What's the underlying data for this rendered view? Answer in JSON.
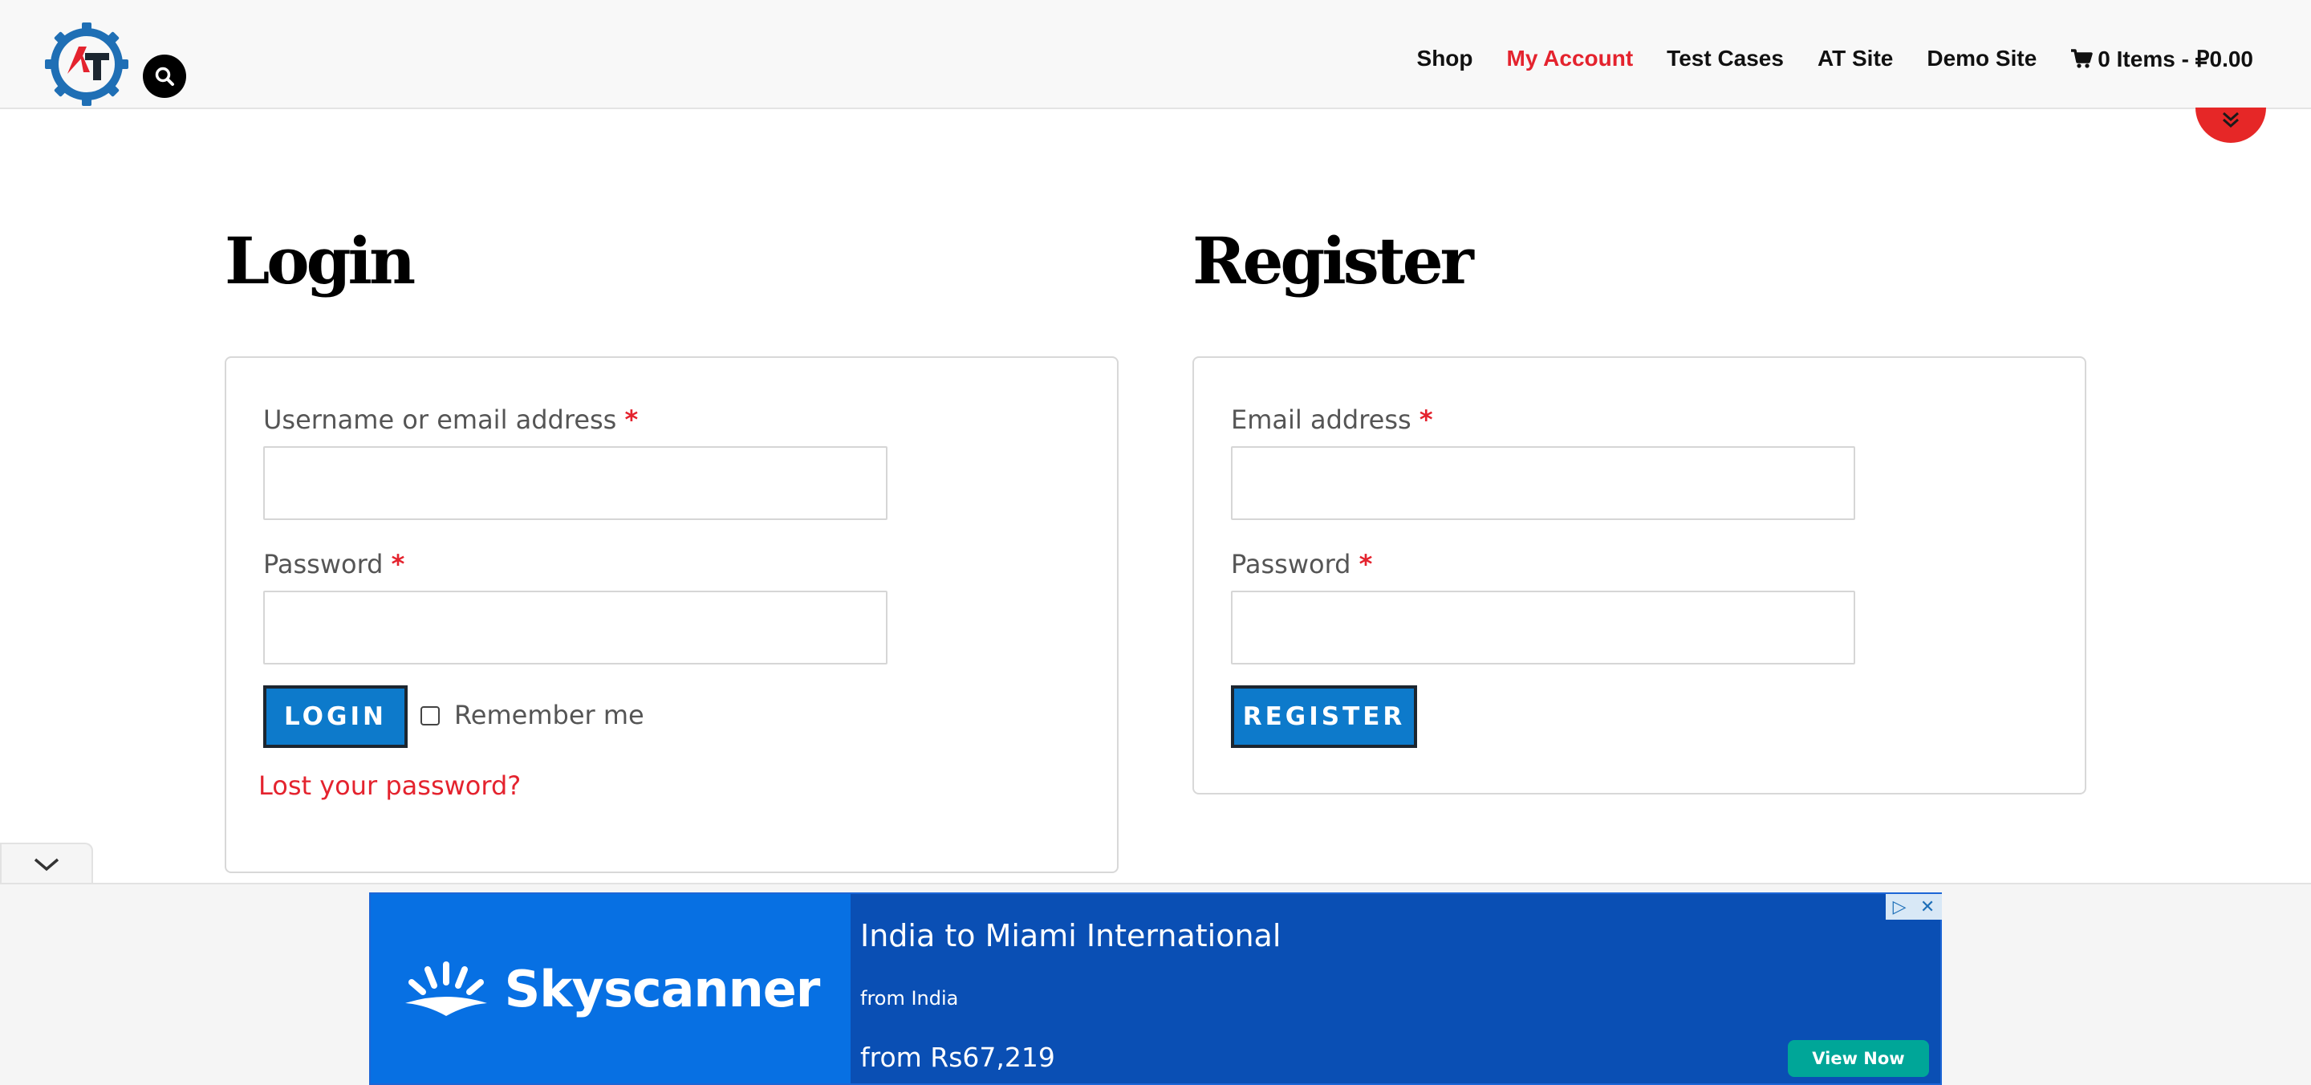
{
  "header": {
    "logo_text": "AT",
    "nav": [
      {
        "label": "Shop",
        "active": false
      },
      {
        "label": "My Account",
        "active": true
      },
      {
        "label": "Test Cases",
        "active": false
      },
      {
        "label": "AT Site",
        "active": false
      },
      {
        "label": "Demo Site",
        "active": false
      }
    ],
    "cart_label": "0 Items - ₽0.00"
  },
  "login": {
    "title": "Login",
    "username_label": "Username or email address",
    "password_label": "Password",
    "required_mark": "*",
    "username_value": "",
    "password_value": "",
    "login_button": "LOGIN",
    "remember_label": "Remember me",
    "remember_checked": false,
    "lost_password": "Lost your password?"
  },
  "register": {
    "title": "Register",
    "email_label": "Email address",
    "password_label": "Password",
    "required_mark": "*",
    "email_value": "",
    "password_value": "",
    "register_button": "REGISTER"
  },
  "ad": {
    "brand": "Skyscanner",
    "title": "India to Miami International",
    "subtitle": "from India",
    "price": "from Rs67,219",
    "cta": "View Now"
  },
  "colors": {
    "accent_red": "#e4232e",
    "button_blue": "#0d7acb",
    "ad_blue": "#0a4fb4",
    "ad_brand_blue": "#0770e3",
    "cta_teal": "#00a698"
  }
}
